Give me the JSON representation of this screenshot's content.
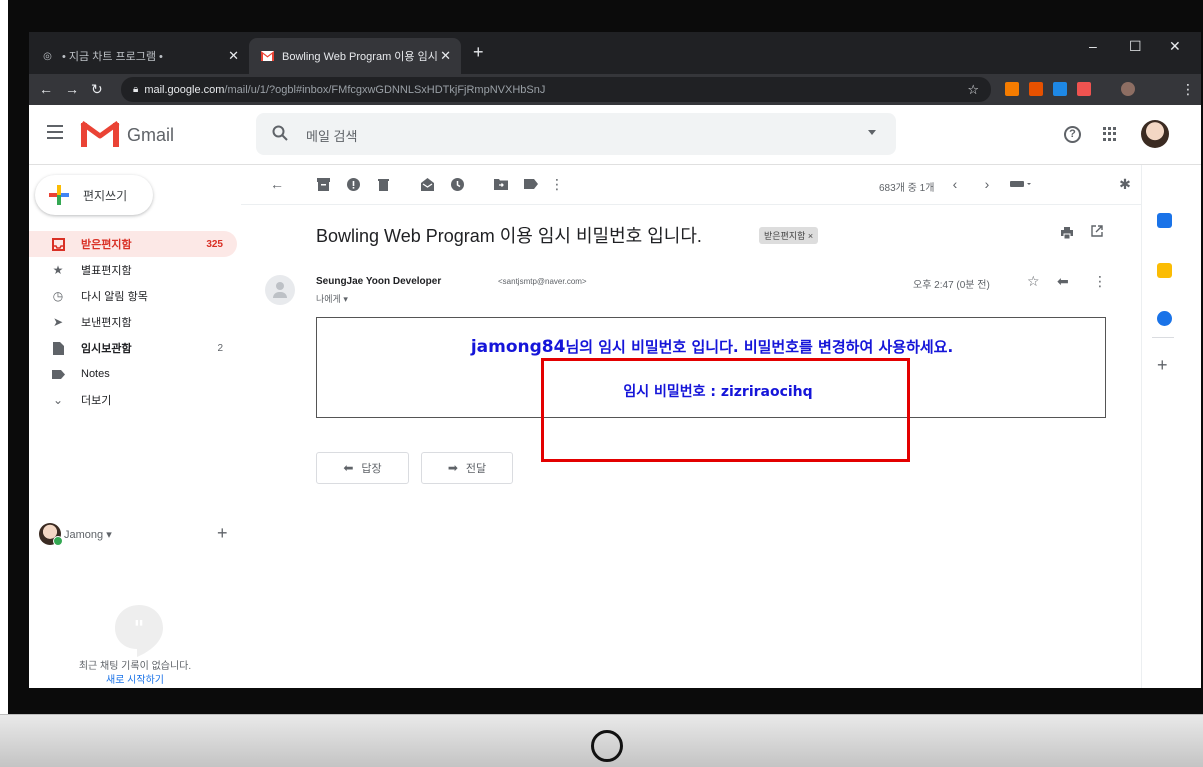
{
  "browser": {
    "tabs": [
      {
        "label": "• 지금 차트 프로그램 •"
      },
      {
        "label": "Bowling Web Program 이용 임시"
      }
    ],
    "url_host": "mail.google.com",
    "url_path": "/mail/u/1/?ogbl#inbox/FMfcgxwGDNNLSxHDTkjFjRmpNVXHbSnJ"
  },
  "gmail": {
    "brand": "Gmail",
    "search_placeholder": "메일 검색"
  },
  "sidebar": {
    "compose_label": "편지쓰기",
    "items": [
      {
        "label": "받은편지함",
        "count": "325",
        "icon": "inbox-icon"
      },
      {
        "label": "별표편지함",
        "count": "",
        "icon": "star-icon"
      },
      {
        "label": "다시 알림 항목",
        "count": "",
        "icon": "clock-icon"
      },
      {
        "label": "보낸편지함",
        "count": "",
        "icon": "send-icon"
      },
      {
        "label": "임시보관함",
        "count": "2",
        "icon": "draft-icon"
      },
      {
        "label": "Notes",
        "count": "",
        "icon": "label-icon"
      },
      {
        "label": "더보기",
        "count": "",
        "icon": "chevron-down-icon"
      }
    ],
    "chat_user": "Jamong ▾",
    "no_chat": "최근 채팅 기록이 없습니다.",
    "start_chat": "새로 시작하기"
  },
  "toolbar": {
    "page_info": "683개 중 1개"
  },
  "email": {
    "subject": "Bowling Web Program 이용 임시 비밀번호 입니다.",
    "label_chip": "받은편지함 ×",
    "sender_name": "SeungJae Yoon Developer",
    "sender_email": "<santjsmtp@naver.com>",
    "to": "나에게 ▾",
    "time": "오후 2:47 (0분 전)",
    "body_userid": "jamong84",
    "body_line1_rest": "님의 임시 비밀번호 입니다. 비밀번호를 변경하여 사용하세요.",
    "body_line2": "임시 비밀번호 : zizriraocihq"
  },
  "actions": {
    "reply": "답장",
    "forward": "전달"
  },
  "colors": {
    "accent_red": "#d93025",
    "body_blue": "#1515d9",
    "highlight_red": "#e30000"
  }
}
